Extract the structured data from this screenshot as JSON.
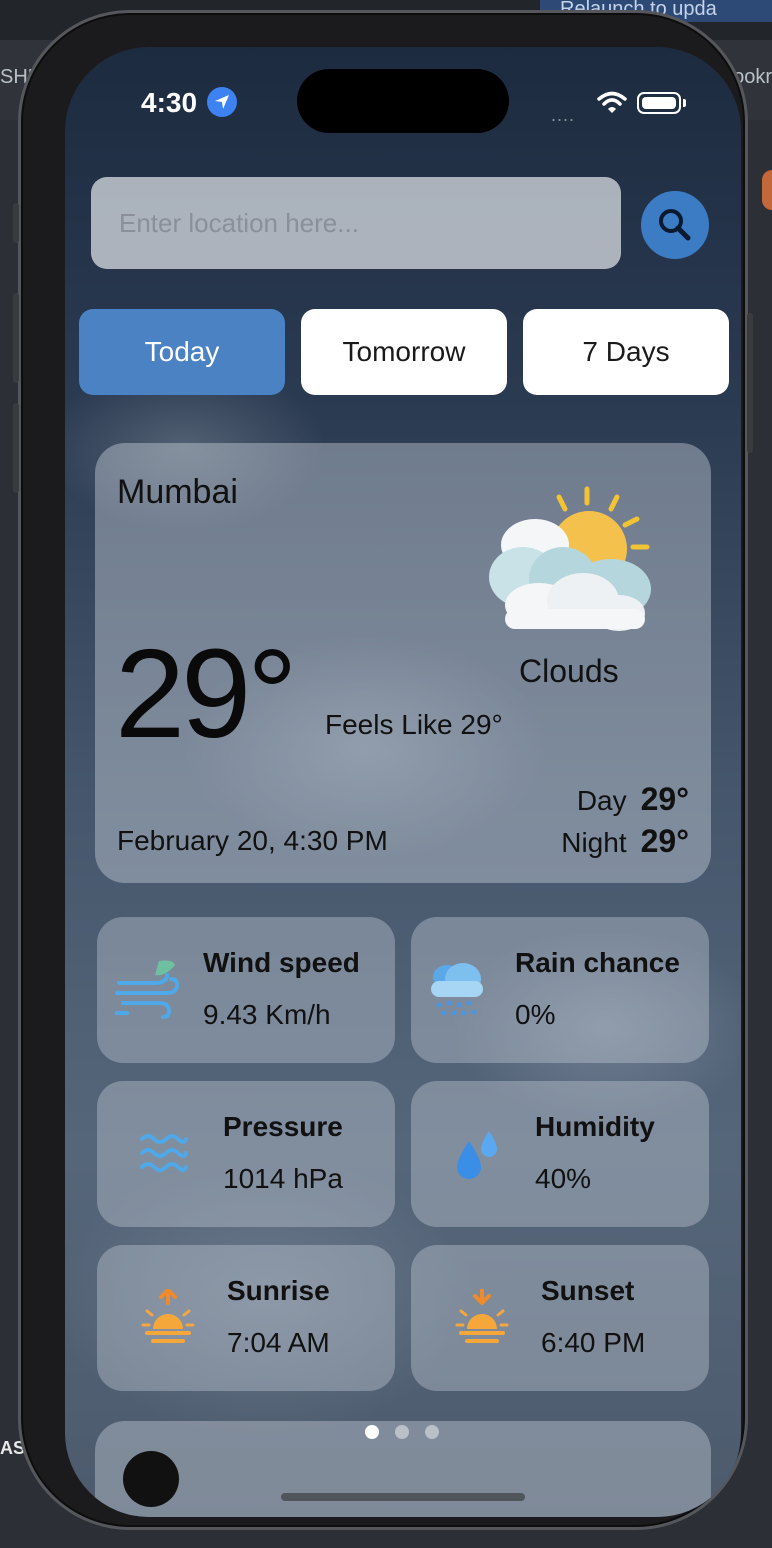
{
  "desktop": {
    "left_text": "SHE",
    "right_text": "ookr",
    "relaunch": "Relaunch to upda",
    "bottom_left": "AS"
  },
  "status_bar": {
    "time": "4:30",
    "signal": "....",
    "location_icon": "location-arrow-icon",
    "wifi_icon": "wifi-icon",
    "battery_icon": "battery-icon"
  },
  "search": {
    "placeholder": "Enter location here...",
    "value": "",
    "icon": "search-icon"
  },
  "tabs": [
    {
      "label": "Today",
      "active": true
    },
    {
      "label": "Tomorrow",
      "active": false
    },
    {
      "label": "7 Days",
      "active": false
    }
  ],
  "current": {
    "city": "Mumbai",
    "temperature": "29°",
    "condition": "Clouds",
    "feels_like": "Feels Like 29°",
    "date": "February 20, 4:30 PM",
    "day_label": "Day",
    "day_temp": "29°",
    "night_label": "Night",
    "night_temp": "29°",
    "icon": "partly-cloudy-icon"
  },
  "stats": [
    {
      "title": "Wind speed",
      "value": "9.43 Km/h",
      "icon": "wind-icon"
    },
    {
      "title": "Rain chance",
      "value": "0%",
      "icon": "rain-cloud-icon"
    },
    {
      "title": "Pressure",
      "value": "1014 hPa",
      "icon": "waves-icon"
    },
    {
      "title": "Humidity",
      "value": "40%",
      "icon": "water-drops-icon"
    },
    {
      "title": "Sunrise",
      "value": "7:04 AM",
      "icon": "sunrise-icon"
    },
    {
      "title": "Sunset",
      "value": "6:40 PM",
      "icon": "sunset-icon"
    }
  ],
  "pagination": {
    "pages": 3,
    "active": 1
  },
  "colors": {
    "accent": "#4a82c3",
    "search_button": "#3c7cc4",
    "location_badge": "#3d82f0"
  }
}
